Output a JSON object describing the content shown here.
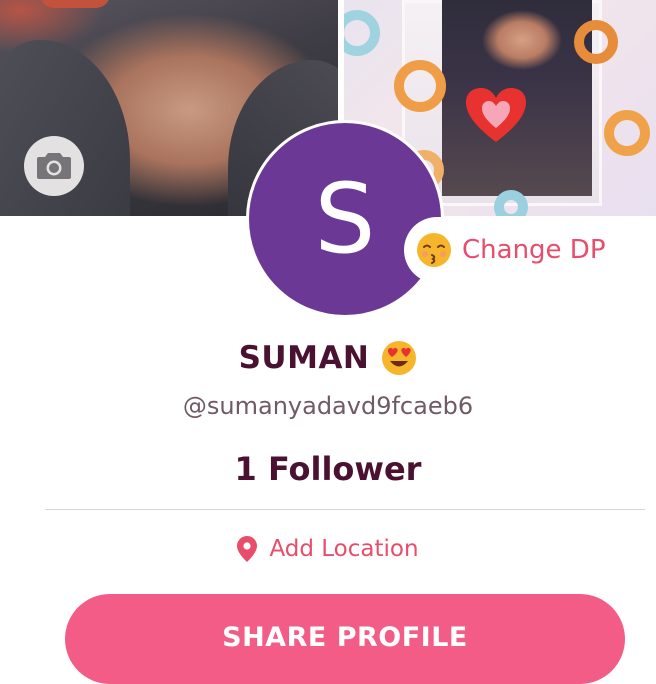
{
  "profile": {
    "initial": "S",
    "name": "SUMAN",
    "name_emoji": "smiling-face-with-heart-eyes",
    "username": "@sumanyadavd9fcaeb6",
    "followers": "1 Follower",
    "change_dp_label": "Change DP",
    "change_dp_emoji": "kissing-face-with-closed-eyes",
    "location_label": "Add Location",
    "share_label": "SHARE PROFILE"
  },
  "icons": {
    "camera": "camera-icon",
    "location": "location-pin-icon"
  },
  "colors": {
    "avatar": "#6c3895",
    "accent": "#e84d6c",
    "button": "#f35c87",
    "name": "#4a1230"
  }
}
